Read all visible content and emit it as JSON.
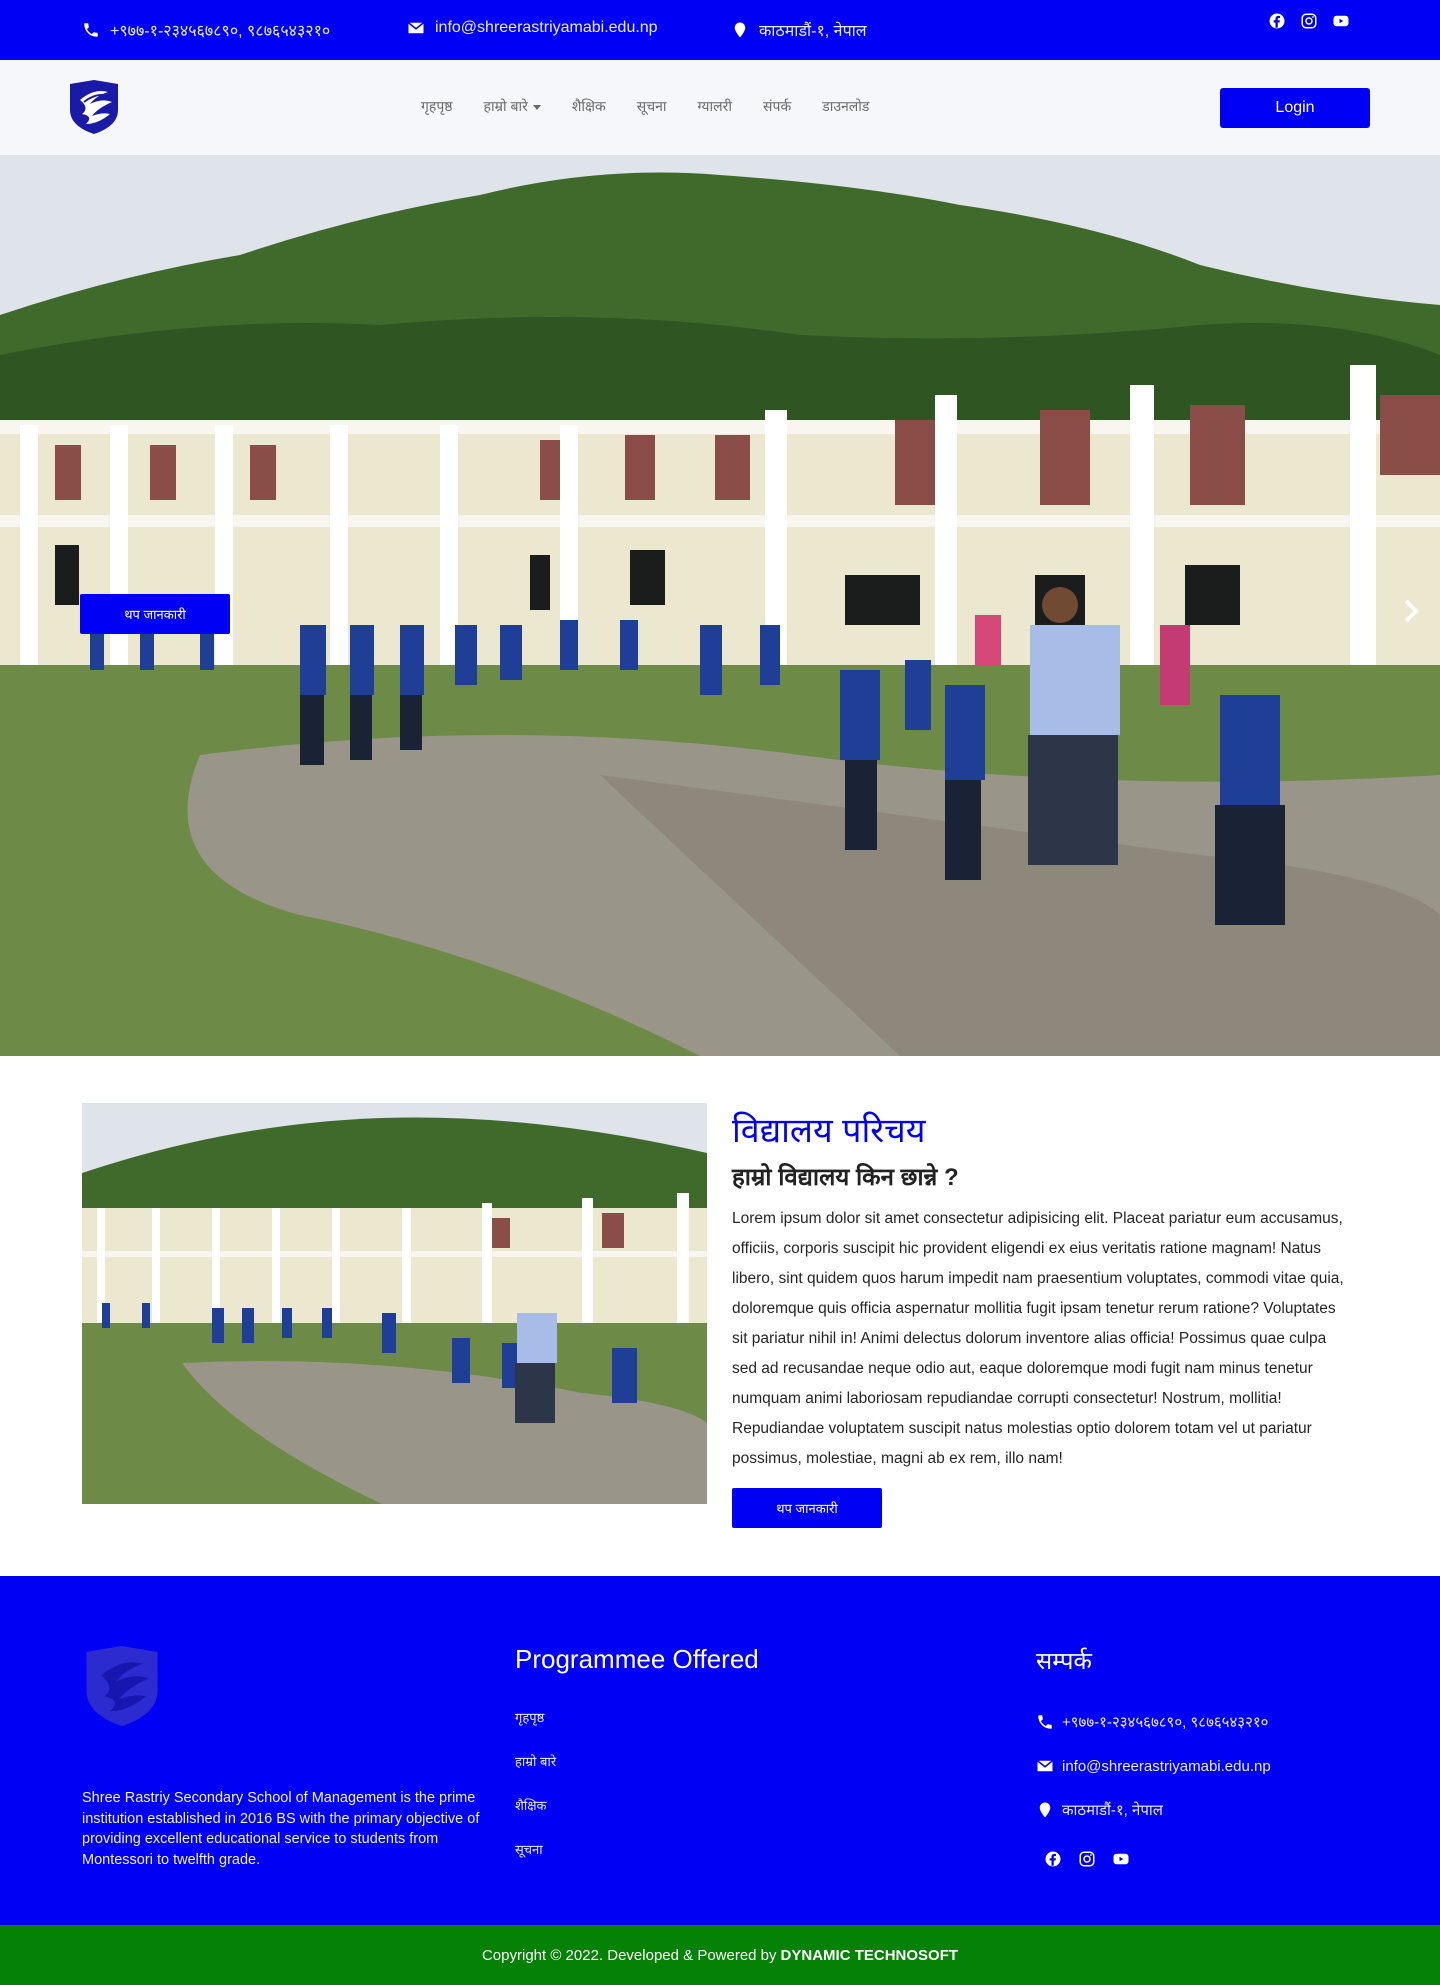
{
  "topbar": {
    "phone": "+९७७-१-२३४५६७८९०, ९८७६५४३२१०",
    "email": "info@shreerastriyamabi.edu.np",
    "address": "काठमाडौं-१, नेपाल",
    "social": [
      "facebook-icon",
      "instagram-icon",
      "youtube-icon"
    ]
  },
  "nav": {
    "items": [
      "गृहपृष्ठ",
      "हाम्रो बारे",
      "शैक्षिक",
      "सूचना",
      "ग्यालरी",
      "संपर्क",
      "डाउनलोड"
    ],
    "login_label": "Login"
  },
  "hero": {
    "button_label": "थप जानकारी"
  },
  "about": {
    "title": "विद्यालय परिचय",
    "subtitle": "हाम्रो विद्यालय किन छान्ने ?",
    "text": "Lorem ipsum dolor sit amet consectetur adipisicing elit. Placeat pariatur eum accusamus, officiis, corporis suscipit hic provident eligendi ex eius veritatis ratione magnam! Natus libero, sint quidem quos harum impedit nam praesentium voluptates, commodi vitae quia, doloremque quis officia aspernatur mollitia fugit ipsam tenetur rerum ratione? Voluptates sit pariatur nihil in! Animi delectus dolorum inventore alias officia! Possimus quae culpa sed ad recusandae neque odio aut, eaque doloremque modi fugit nam minus tenetur numquam animi laboriosam repudiandae corrupti consectetur! Nostrum, mollitia! Repudiandae voluptatem suscipit natus molestias optio dolorem totam vel ut pariatur possimus, molestiae, magni ab ex rem, illo nam!",
    "button_label": "थप जानकारी"
  },
  "footer": {
    "description": "Shree Rastriy Secondary School of Management is the prime institution established in 2016 BS with the primary objective of providing excellent educational service to students from Montessori to twelfth grade.",
    "programmes_title": "Programmee Offered",
    "programmes": [
      "गृहपृष्ठ",
      "हाम्रो बारे",
      "शैक्षिक",
      "सूचना"
    ],
    "contact_title": "सम्पर्क",
    "phone": "+९७७-१-२३४५६७८९०, ९८७६५४३२१०",
    "email": "info@shreerastriyamabi.edu.np",
    "address": "काठमाडौं-१, नेपाल"
  },
  "copyright": {
    "text": "Copyright © 2022. Developed & Powered by",
    "company": "DYNAMIC TECHNOSOFT"
  },
  "colors": {
    "primary": "#0000f5",
    "footer_bottom": "#058105"
  }
}
